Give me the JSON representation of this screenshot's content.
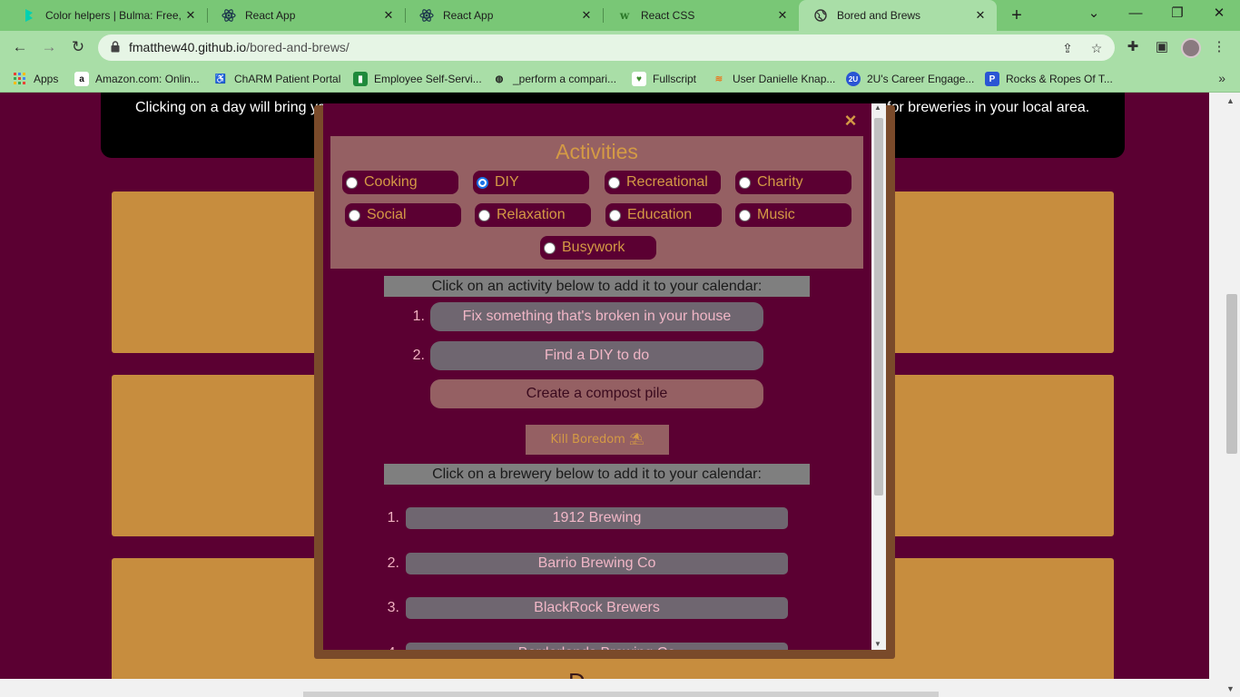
{
  "browser": {
    "tabs": [
      {
        "title": "Color helpers | Bulma: Free, o",
        "icon": "bulma-icon"
      },
      {
        "title": "React App",
        "icon": "react-icon"
      },
      {
        "title": "React App",
        "icon": "react-icon"
      },
      {
        "title": "React CSS",
        "icon": "w3schools-icon"
      },
      {
        "title": "Bored and Brews",
        "icon": "globe-icon",
        "active": true
      }
    ],
    "url_host": "fmatthew40.github.io",
    "url_path": "/bored-and-brews/",
    "bookmarks": [
      {
        "label": "Apps",
        "icon": "apps-grid-icon"
      },
      {
        "label": "Amazon.com: Onlin...",
        "icon": "amazon-icon"
      },
      {
        "label": "ChARM Patient Portal",
        "icon": "charm-icon"
      },
      {
        "label": "Employee Self-Servi...",
        "icon": "employee-icon"
      },
      {
        "label": "_perform a compari...",
        "icon": "globe-icon"
      },
      {
        "label": "Fullscript",
        "icon": "fullscript-icon"
      },
      {
        "label": "User Danielle Knap...",
        "icon": "stack-icon"
      },
      {
        "label": "2U's Career Engage...",
        "icon": "2u-icon"
      },
      {
        "label": "Rocks & Ropes Of T...",
        "icon": "p-icon"
      }
    ]
  },
  "page": {
    "banner_left": "Clicking on a day will bring yo",
    "banner_right": "for breweries in your local area.",
    "bottom_partial": "D"
  },
  "modal": {
    "close_label": "×",
    "activities_title": "Activities",
    "activities": [
      {
        "label": "Cooking",
        "checked": false
      },
      {
        "label": "DIY",
        "checked": true
      },
      {
        "label": "Recreational",
        "checked": false
      },
      {
        "label": "Charity",
        "checked": false
      },
      {
        "label": "Social",
        "checked": false
      },
      {
        "label": "Relaxation",
        "checked": false
      },
      {
        "label": "Education",
        "checked": false
      },
      {
        "label": "Music",
        "checked": false
      },
      {
        "label": "Busywork",
        "checked": false
      }
    ],
    "activity_prompt": "Click on an activity below to add it to your calendar:",
    "activity_ideas": [
      {
        "num": "1.",
        "label": "Fix something that's broken in your house"
      },
      {
        "num": "2.",
        "label": "Find a DIY to do"
      },
      {
        "num": "",
        "label": "Create a compost pile"
      }
    ],
    "kill_button": "Kill Boredom ⛱",
    "brewery_prompt": "Click on a brewery below to add it to your calendar:",
    "breweries": [
      {
        "num": "1.",
        "label": "1912 Brewing"
      },
      {
        "num": "2.",
        "label": "Barrio Brewing Co"
      },
      {
        "num": "3.",
        "label": "BlackRock Brewers"
      },
      {
        "num": "4.",
        "label": "Borderlands Brewing Co"
      }
    ]
  },
  "colors": {
    "page_bg": "#5b0032",
    "accent": "#d49a45",
    "card": "#c78d3e",
    "panel": "#956063",
    "button": "#6f6670"
  }
}
